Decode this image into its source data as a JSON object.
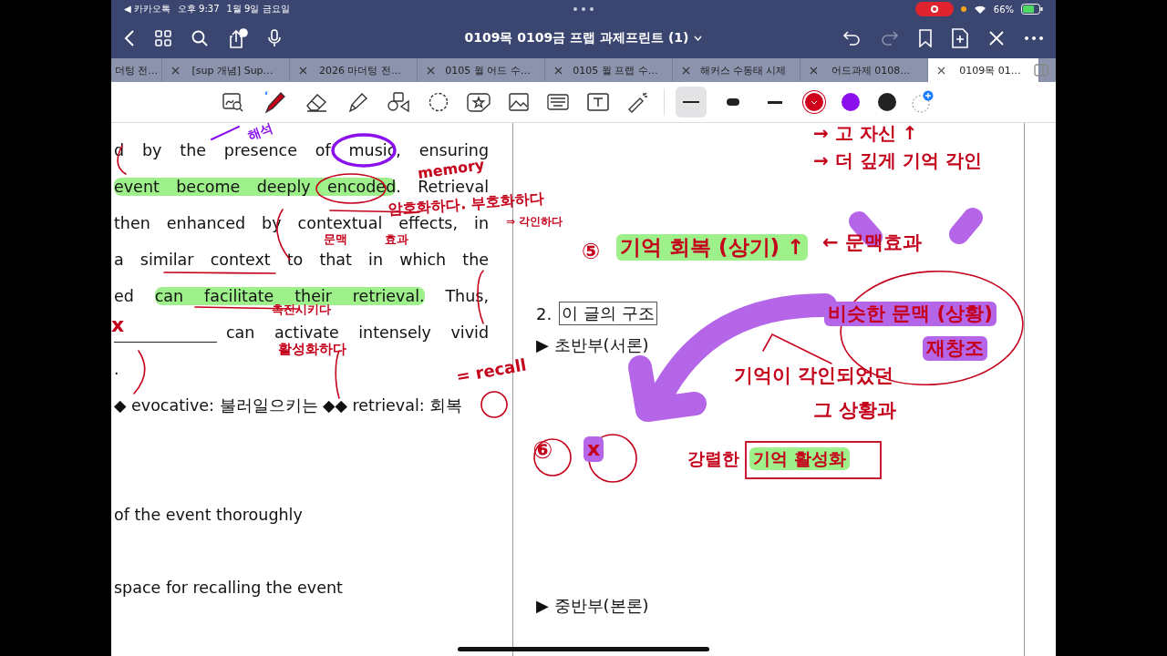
{
  "status_bar": {
    "back_app": "◀ 카카오톡",
    "time": "오후 9:37",
    "date": "1월 9일 금요일",
    "battery": "66%",
    "recording": true
  },
  "nav": {
    "title": "0109목 0109금 프랩 과제프린트 (1)"
  },
  "tabs": [
    {
      "label": "더텅 전…",
      "selected": false
    },
    {
      "label": "[sup 개념] Sup…",
      "selected": false
    },
    {
      "label": "2026 마더텅 전…",
      "selected": false
    },
    {
      "label": "0105 월 어드 수…",
      "selected": false
    },
    {
      "label": "0105 월 프랩 수…",
      "selected": false
    },
    {
      "label": "해커스 수동태 시제",
      "selected": false
    },
    {
      "label": "어드과제 0108…",
      "selected": false
    },
    {
      "label": "0109목 01…",
      "selected": true
    }
  ],
  "tools": [
    {
      "kind": "zoom"
    },
    {
      "kind": "pen"
    },
    {
      "kind": "eraser"
    },
    {
      "kind": "highlighter"
    },
    {
      "kind": "shapes"
    },
    {
      "kind": "lasso"
    },
    {
      "kind": "sticker"
    },
    {
      "kind": "image"
    },
    {
      "kind": "keyboard"
    },
    {
      "kind": "text"
    },
    {
      "kind": "laser"
    }
  ],
  "stroke_sizes": [
    {
      "selected": true
    },
    {
      "selected": false
    },
    {
      "selected": false
    }
  ],
  "colors": [
    {
      "color": "#d0021b",
      "selected": true
    },
    {
      "color": "#8a10ee",
      "selected": false
    },
    {
      "color": "#222222",
      "selected": false
    }
  ],
  "left_page": [
    {
      "kind": "text",
      "segments": [
        {
          "text": "d by the presence of music, ensuring",
          "highlight": false
        }
      ]
    },
    {
      "kind": "text",
      "segments": [
        {
          "text": "event become deeply encoded",
          "highlight": true
        },
        {
          "text": ". Retrieval",
          "highlight": false
        }
      ]
    },
    {
      "kind": "text",
      "segments": [
        {
          "text": "then enhanced by contextual effects, in",
          "highlight": false
        }
      ]
    },
    {
      "kind": "text",
      "segments": [
        {
          "text": "a similar context to that in which the",
          "highlight": false
        }
      ]
    },
    {
      "kind": "text",
      "segments": [
        {
          "text": "ed ",
          "highlight": false
        },
        {
          "text": "can facilitate their retrieval.",
          "highlight": true
        },
        {
          "text": " Thus,",
          "highlight": false
        }
      ]
    },
    {
      "kind": "blank",
      "segments": [
        {
          "text": "can activate intensely vivid",
          "highlight": false
        }
      ]
    },
    {
      "kind": "short",
      "segments": [
        {
          "text": ".",
          "highlight": false
        }
      ]
    },
    {
      "kind": "short",
      "segments": [
        {
          "text": "◆ evocative: 불러일으키는 ◆◆ retrieval: 회복",
          "highlight": false
        }
      ]
    },
    {
      "kind": "short",
      "segments": [
        {
          "text": "of the event thoroughly",
          "highlight": false
        }
      ]
    },
    {
      "kind": "short",
      "segments": [
        {
          "text": "space for recalling the event",
          "highlight": false
        }
      ]
    }
  ],
  "right_page": {
    "heading_number": "2.",
    "heading": "이 글의 구조",
    "sections": [
      "▶ 초반부(서론)",
      "▶ 중반부(본론)"
    ]
  },
  "annotations": [
    {
      "text": "해석",
      "kind": "purple_ink"
    },
    {
      "text": "memory",
      "kind": "ink"
    },
    {
      "text": "암호화하다. 부호화하다",
      "kind": "ink"
    },
    {
      "text": "⇒ 각인하다",
      "kind": "ink"
    },
    {
      "text": "문맥",
      "kind": "ink"
    },
    {
      "text": "효과",
      "kind": "ink"
    },
    {
      "text": "촉진시키다",
      "kind": "ink"
    },
    {
      "text": "활성화하다",
      "kind": "ink"
    },
    {
      "text": "= recall",
      "kind": "ink"
    },
    {
      "text": "x",
      "kind": "ink"
    },
    {
      "text": "→ 고 자신 ↑",
      "kind": "ink"
    },
    {
      "text": "→ 더 깊게 기억 각인",
      "kind": "ink"
    },
    {
      "text": "⑤",
      "kind": "ink"
    },
    {
      "text": "기억 회복 (상기) ↑",
      "kind": "ink_on_green"
    },
    {
      "text": "← 문맥효과",
      "kind": "ink"
    },
    {
      "text": "비슷한 문맥 (상황)",
      "kind": "ink_on_purple"
    },
    {
      "text": "재창조",
      "kind": "ink_on_purple"
    },
    {
      "text": "기억이 각인되었던",
      "kind": "ink"
    },
    {
      "text": "그 상황과",
      "kind": "ink"
    },
    {
      "text": "⑥",
      "kind": "ink"
    },
    {
      "text": "x",
      "kind": "ink_on_purple"
    },
    {
      "text": "강렬한",
      "kind": "ink"
    },
    {
      "text": "기억 활성화",
      "kind": "ink_on_green"
    }
  ]
}
